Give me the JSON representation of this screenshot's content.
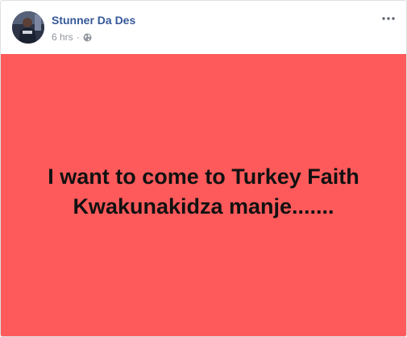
{
  "post": {
    "author": "Stunner Da Des",
    "timestamp": "6 hrs",
    "meta_separator": "·",
    "privacy_icon": "globe-icon",
    "options_icon": "more-horizontal-icon",
    "background_color": "#ff5a5b",
    "status_lines": [
      "I want to come to Turkey Faith",
      "Kwakunakidza manje......."
    ]
  }
}
